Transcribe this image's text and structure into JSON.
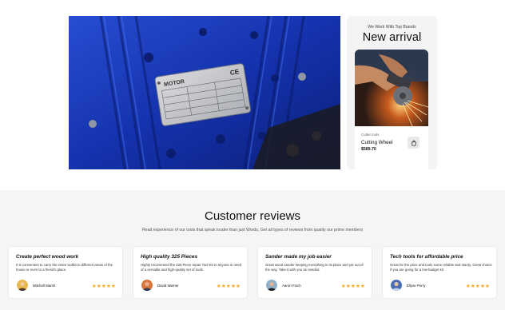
{
  "hero": {
    "image_alt": "Electric motor nameplate",
    "nameplate_text": "MOTOR",
    "ce_mark": "CE"
  },
  "arrival": {
    "eyebrow": "We Work With Top Brands",
    "title": "New arrival",
    "product": {
      "category": "Cutter tools",
      "name": "Cutting Wheel",
      "price": "$589.70"
    }
  },
  "reviews": {
    "title": "Customer reviews",
    "subtitle": "Read experience of our tools that speak louder than just Words, Get all types of reviews from quality our prime members",
    "items": [
      {
        "heading": "Create perfect wood work",
        "text": "It is convenient to carry the entire toolkit to different areas of the house or even to a friend's place.",
        "name": "Mitchell Marsh",
        "stars": "★★★★★",
        "avatar_color": "#e7b84a"
      },
      {
        "heading": "High quality 325 Pieces",
        "text": "Highly recommend the 325 Piece repair Tool Kit to anyone in need of a versatile and high-quality set of tools.",
        "name": "David Warner",
        "stars": "★★★★★",
        "avatar_color": "#d9753a"
      },
      {
        "heading": "Sander made my job easier",
        "text": "Great wood sander keeping everything in its place and yet out of the way. Take it with you as needed.",
        "name": "Aaron Finch",
        "stars": "★★★★★",
        "avatar_color": "#8fb0c9"
      },
      {
        "heading": "Tech tools for affordable price",
        "text": "Great for the price and tools some reliable and sturdy. Great choice if you are going for a low-budget kit",
        "name": "Ellyse Perry",
        "stars": "★★★★★",
        "avatar_color": "#4a6fb5"
      }
    ]
  },
  "colors": {
    "star": "#f5a623",
    "motor_blue": "#1a3fc4",
    "section_bg": "#f5f5f6"
  }
}
